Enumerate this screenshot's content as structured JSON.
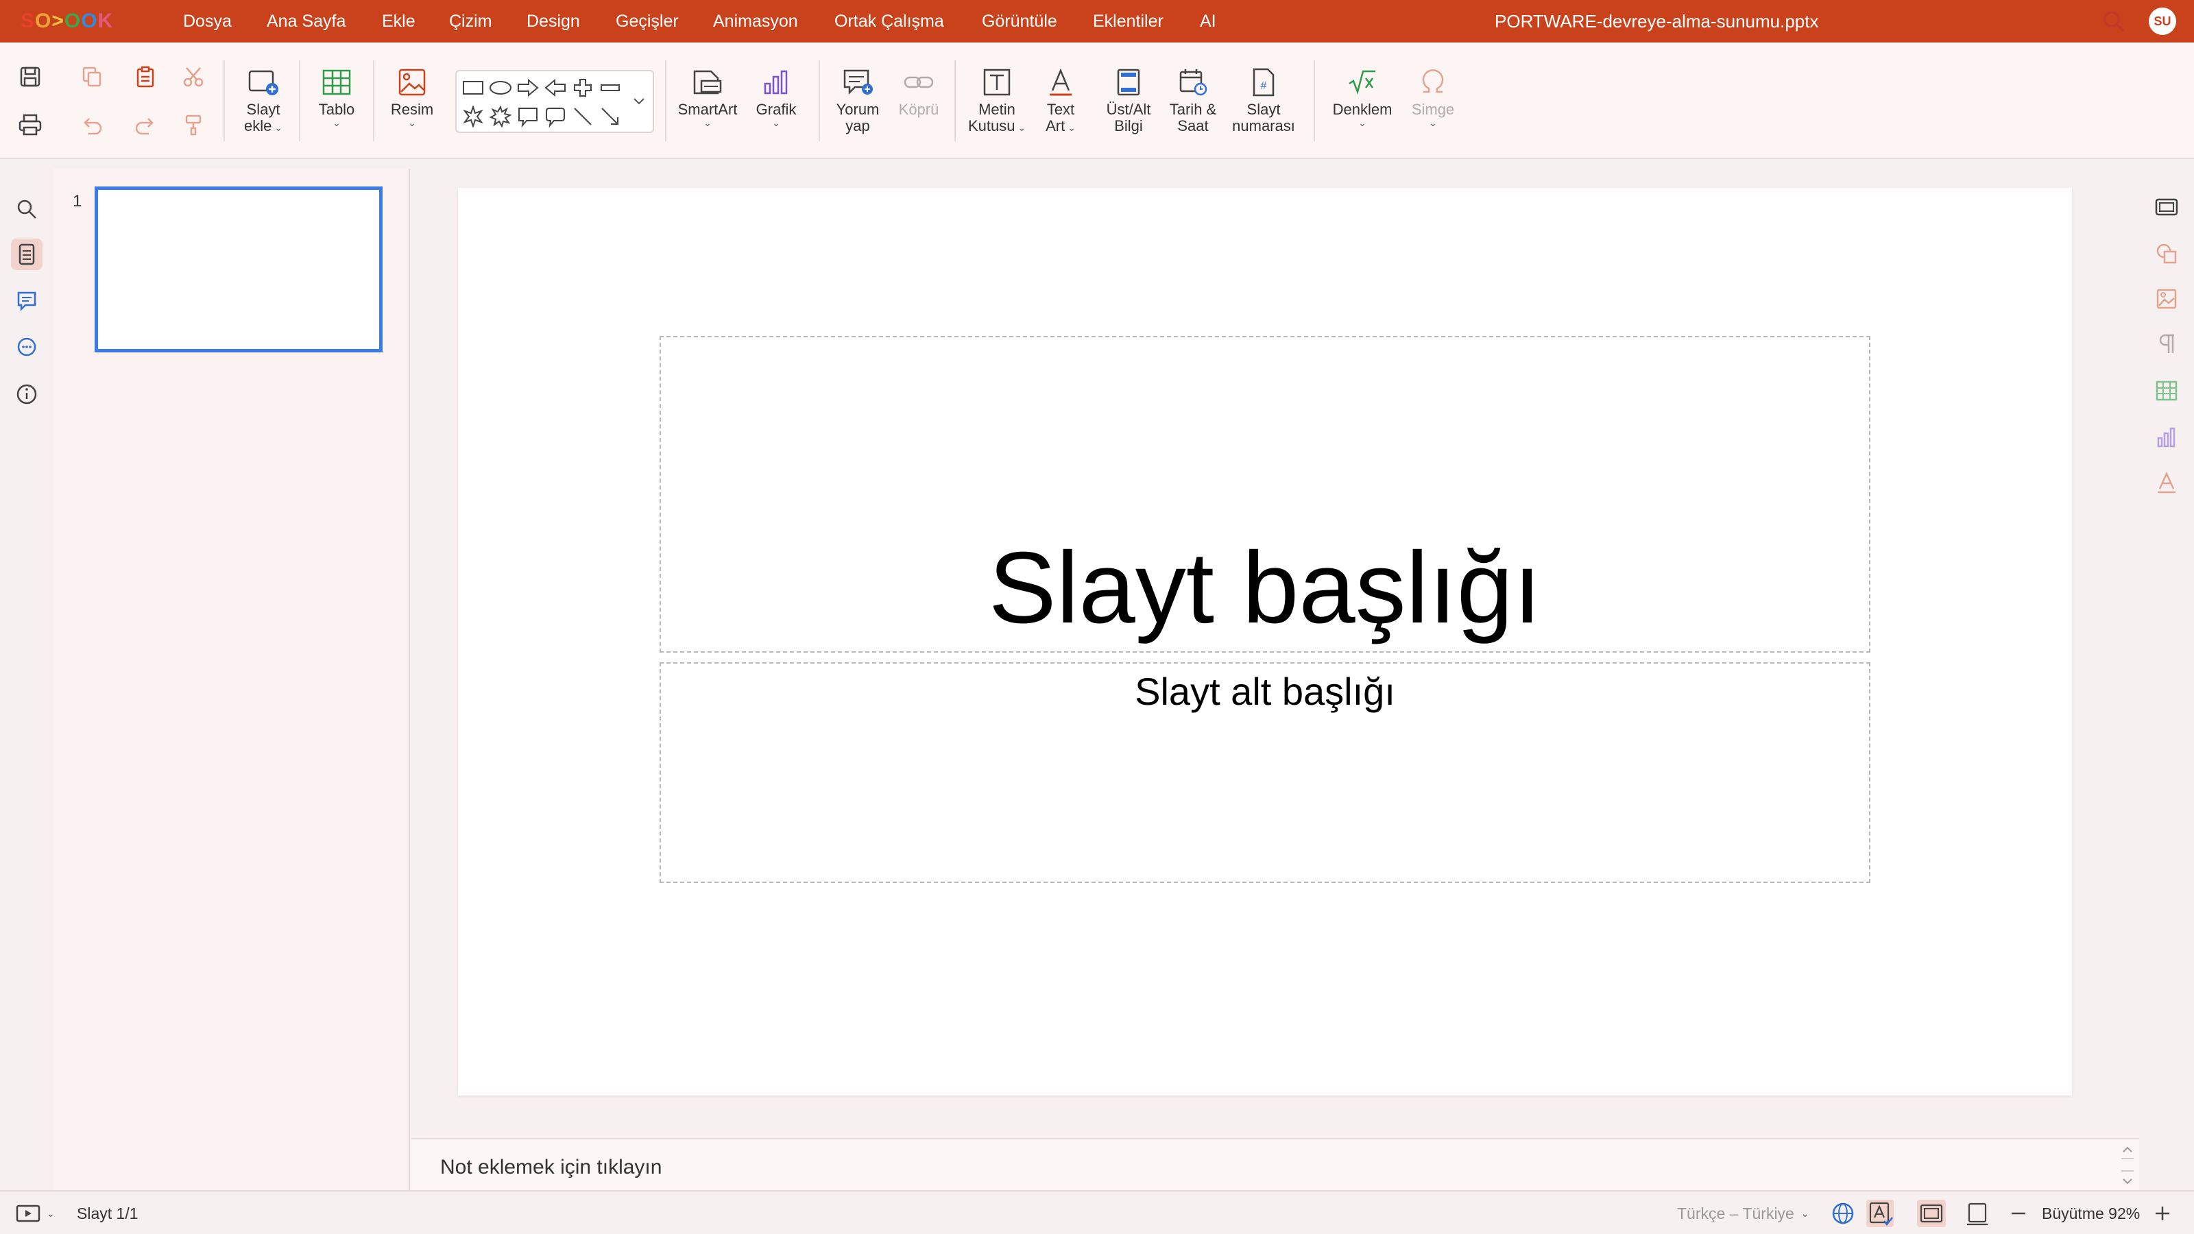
{
  "app": {
    "logo_letters": [
      "S",
      "O",
      ">",
      "O",
      "O",
      "K"
    ],
    "logo_colors": [
      "#e8412c",
      "#f0a23a",
      "#f7c23b",
      "#3ea64a",
      "#2f8bdc",
      "#e35a7c"
    ],
    "document_title": "PORTWARE-devreye-alma-sunumu.pptx",
    "user_initials": "SU",
    "accent_color": "#c9421b"
  },
  "menu": {
    "items": [
      "Dosya",
      "Ana Sayfa",
      "Ekle",
      "Çizim",
      "Design",
      "Geçişler",
      "Animasyon",
      "Ortak Çalışma",
      "Görüntüle",
      "Eklentiler",
      "AI"
    ]
  },
  "ribbon": {
    "add_slide": [
      "Slayt",
      "ekle"
    ],
    "table": "Tablo",
    "image": "Resim",
    "smartart": "SmartArt",
    "chart": "Grafik",
    "comment": [
      "Yorum",
      "yap"
    ],
    "link": "Köprü",
    "textbox": [
      "Metin",
      "Kutusu"
    ],
    "textart": [
      "Text",
      "Art"
    ],
    "header_footer": [
      "Üst/Alt",
      "Bilgi"
    ],
    "date_time": [
      "Tarih &",
      "Saat"
    ],
    "slide_number": [
      "Slayt",
      "numarası"
    ],
    "equation": "Denklem",
    "symbol": "Simge"
  },
  "thumbnails": {
    "items": [
      {
        "number": "1"
      }
    ]
  },
  "slide": {
    "title": "Slayt başlığı",
    "subtitle": "Slayt alt başlığı"
  },
  "notes": {
    "placeholder": "Not eklemek için tıklayın"
  },
  "status": {
    "slide_counter": "Slayt 1/1",
    "language": "Türkçe – Türkiye",
    "zoom_label": "Büyütme 92%"
  }
}
